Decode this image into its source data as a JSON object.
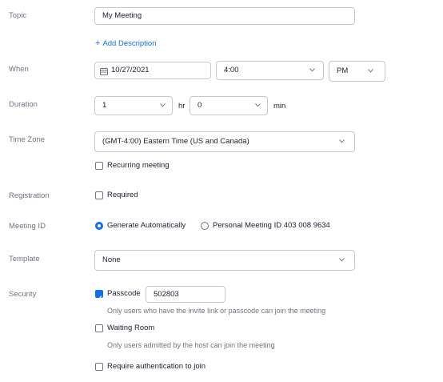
{
  "labels": {
    "topic": "Topic",
    "when": "When",
    "duration": "Duration",
    "time_zone": "Time Zone",
    "registration": "Registration",
    "meeting_id": "Meeting ID",
    "template": "Template",
    "security": "Security"
  },
  "topic": {
    "value": "My Meeting"
  },
  "add_description": {
    "icon": "+",
    "label": "Add Description"
  },
  "when": {
    "date": "10/27/2021",
    "time": "4:00",
    "ampm": "PM"
  },
  "duration": {
    "hours": "1",
    "hr_unit": "hr",
    "minutes": "0",
    "min_unit": "min"
  },
  "time_zone": {
    "value": "(GMT-4:00) Eastern Time (US and Canada)"
  },
  "recurring": {
    "label": "Recurring meeting",
    "checked": false
  },
  "registration": {
    "label": "Required",
    "checked": false
  },
  "meeting_id": {
    "option_auto": "Generate Automatically",
    "option_personal": "Personal Meeting ID 403 008 9634",
    "selected": "auto"
  },
  "template": {
    "value": "None"
  },
  "security": {
    "passcode_label": "Passcode",
    "passcode_value": "502803",
    "passcode_checked": true,
    "passcode_hint": "Only users who have the invite link or passcode can join the meeting",
    "waiting_room_label": "Waiting Room",
    "waiting_room_checked": false,
    "waiting_room_hint": "Only users admitted by the host can join the meeting",
    "auth_label": "Require authentication to join",
    "auth_checked": false
  },
  "colors": {
    "accent": "#0e71eb",
    "label": "#6e7680",
    "border": "#c6c8cc",
    "text": "#232333"
  }
}
